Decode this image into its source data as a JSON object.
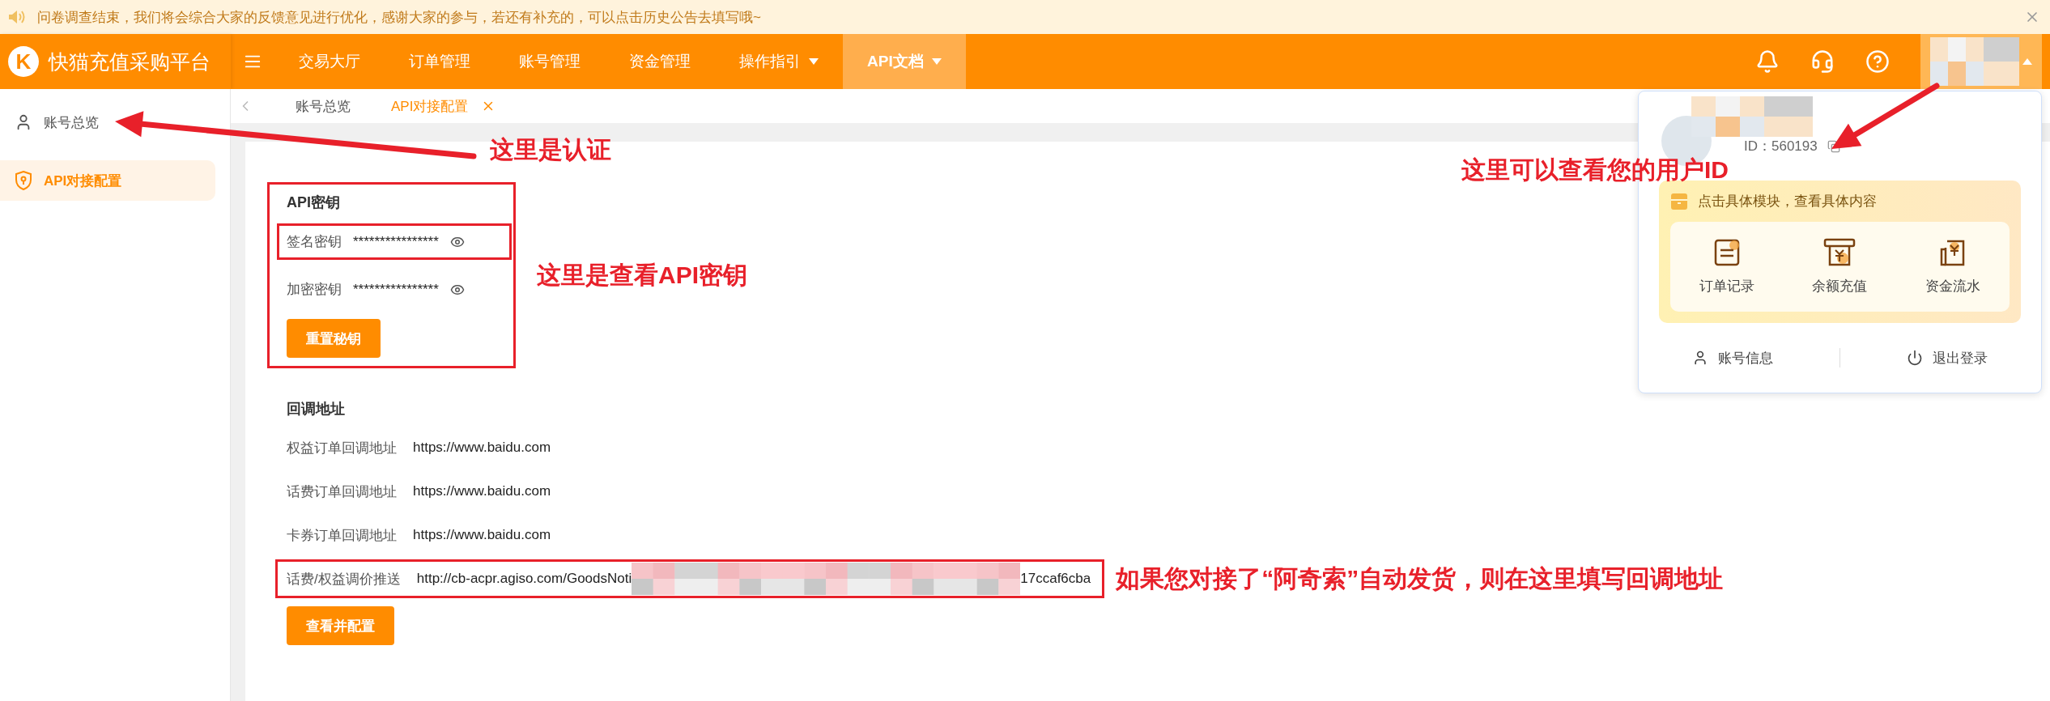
{
  "notice": {
    "text": "问卷调查结束，我们将会综合大家的反馈意见进行优化，感谢大家的参与，若还有补充的，可以点击历史公告去填写哦~"
  },
  "header": {
    "logo_letter": "K",
    "title": "快猫充值采购平台",
    "nav": [
      {
        "label": "交易大厅",
        "selected": false,
        "dropdown": false
      },
      {
        "label": "订单管理",
        "selected": false,
        "dropdown": false
      },
      {
        "label": "账号管理",
        "selected": false,
        "dropdown": false
      },
      {
        "label": "资金管理",
        "selected": false,
        "dropdown": false
      },
      {
        "label": "操作指引",
        "selected": false,
        "dropdown": true
      },
      {
        "label": "API文档",
        "selected": true,
        "dropdown": true
      }
    ]
  },
  "sidebar": {
    "items": [
      {
        "label": "账号总览",
        "selected": false
      },
      {
        "label": "API对接配置",
        "selected": true
      }
    ]
  },
  "tabs": [
    {
      "label": "账号总览",
      "selected": false
    },
    {
      "label": "API对接配置",
      "selected": true
    }
  ],
  "api_keys": {
    "title": "API密钥",
    "highlighted": true,
    "fields": [
      {
        "label": "签名密钥",
        "value": "****************",
        "highlighted": true
      },
      {
        "label": "加密密钥",
        "value": "****************",
        "highlighted": false
      }
    ],
    "button": "重置秘钥"
  },
  "callbacks": {
    "title": "回调地址",
    "rows": [
      {
        "label": "权益订单回调地址",
        "value": "https://www.baidu.com",
        "highlighted": false,
        "redacted": false
      },
      {
        "label": "话费订单回调地址",
        "value": "https://www.baidu.com",
        "highlighted": false,
        "redacted": false
      },
      {
        "label": "卡券订单回调地址",
        "value": "https://www.baidu.com",
        "highlighted": false,
        "redacted": false
      },
      {
        "label": "话费/权益调价推送",
        "value": "http://cb-acpr.agiso.com/GoodsNoti",
        "value_end": "17ccaf6cba",
        "highlighted": true,
        "redacted": true
      }
    ],
    "button": "查看并配置"
  },
  "user_menu": {
    "open": true,
    "id_text": "ID：560193",
    "hint": "点击具体模块，查看具体内容",
    "shortcuts": [
      {
        "label": "订单记录"
      },
      {
        "label": "余额充值"
      },
      {
        "label": "资金流水"
      }
    ],
    "actions": [
      {
        "label": "账号信息"
      },
      {
        "label": "退出登录"
      }
    ]
  },
  "annotations": [
    {
      "text": "这里是认证"
    },
    {
      "text": "这里是查看API密钥"
    },
    {
      "text": "这里可以查看您的用户ID"
    },
    {
      "text": "如果您对接了“阿奇索”自动发货，则在这里填写回调地址"
    }
  ]
}
